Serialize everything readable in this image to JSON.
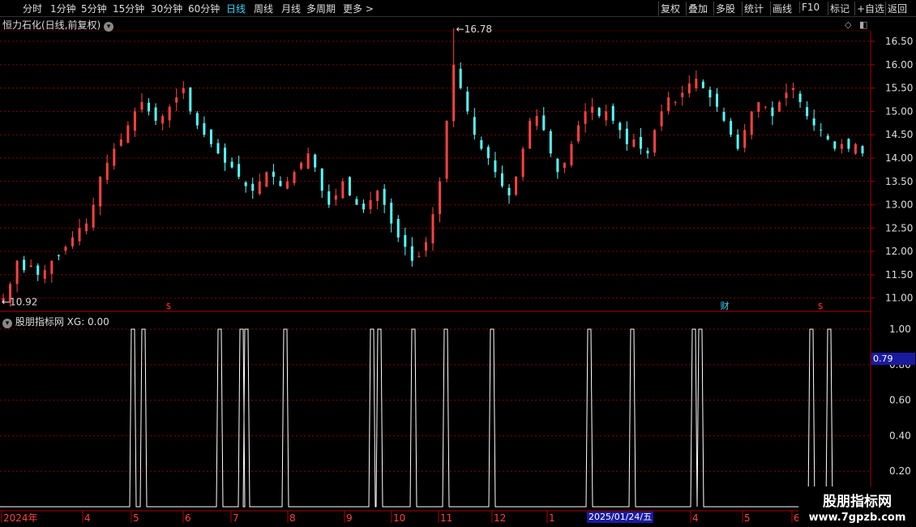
{
  "toolbar": {
    "periods": [
      "分时",
      "1分钟",
      "5分钟",
      "15分钟",
      "30分钟",
      "60分钟",
      "日线",
      "周线",
      "月线",
      "多周期",
      "更多 >"
    ],
    "active_period": "日线",
    "tools": [
      "复权",
      "叠加",
      "多股",
      "统计",
      "画线",
      "F10",
      "标记",
      "+自选",
      "返回"
    ]
  },
  "main_panel": {
    "title": "恒力石化(日线,前复权)",
    "high_label": "16.78",
    "low_label": "10.92",
    "price_axis": [
      "16.50",
      "16.00",
      "15.50",
      "15.00",
      "14.50",
      "14.00",
      "13.50",
      "13.00",
      "12.50",
      "12.00",
      "11.50",
      "11.00"
    ],
    "markers": [
      {
        "text": "$",
        "color": "#ff3030"
      },
      {
        "text": "财",
        "color": "#33d8ff"
      },
      {
        "text": "$",
        "color": "#ff3030"
      }
    ]
  },
  "indicator_panel": {
    "title": "股朋指标网",
    "value_label": "XG: 0.00",
    "axis": [
      "1.00",
      "0.80",
      "0.60",
      "0.40",
      "0.20"
    ],
    "cursor_value": "0.79"
  },
  "date_axis": {
    "labels": [
      "2024年",
      "4",
      "5",
      "6",
      "7",
      "8",
      "9",
      "10",
      "11",
      "12",
      "1",
      "4",
      "5",
      "6"
    ],
    "highlight_date": "2025/01/24/五"
  },
  "watermark": {
    "line1": "股朋指标网",
    "line2": "www.7gpzb.com"
  },
  "colors": {
    "up": "#ff4040",
    "down": "#54fcfc",
    "grid": "#8b0000",
    "signal": "#ffffff",
    "accent": "#33d8ff"
  },
  "chart_data": {
    "type": "candlestick",
    "price_range": [
      10.7,
      16.9
    ],
    "high": 16.78,
    "low": 10.92,
    "close_trajectory": [
      11.0,
      11.3,
      11.8,
      11.6,
      11.7,
      11.5,
      11.6,
      11.8,
      11.9,
      12.1,
      12.3,
      12.5,
      12.6,
      13.0,
      13.6,
      13.9,
      14.2,
      14.4,
      14.7,
      15.0,
      15.2,
      15.0,
      14.8,
      14.9,
      15.1,
      15.3,
      15.5,
      15.0,
      14.7,
      14.5,
      14.3,
      14.1,
      13.9,
      13.8,
      13.6,
      13.4,
      13.3,
      13.5,
      13.7,
      13.6,
      13.4,
      13.5,
      13.7,
      13.9,
      14.1,
      13.8,
      13.3,
      13.0,
      13.2,
      13.5,
      13.2,
      13.0,
      12.9,
      13.1,
      13.3,
      13.0,
      12.6,
      12.3,
      12.1,
      11.8,
      11.9,
      12.2,
      12.8,
      13.5,
      14.8,
      16.0,
      15.5,
      15.0,
      14.5,
      14.2,
      14.0,
      13.7,
      13.4,
      13.2,
      13.6,
      14.2,
      14.8,
      14.9,
      14.6,
      14.1,
      13.7,
      13.9,
      14.3,
      14.7,
      15.0,
      15.1,
      14.9,
      15.0,
      14.8,
      14.6,
      14.3,
      14.4,
      14.2,
      14.1,
      14.6,
      15.0,
      15.3,
      15.2,
      15.4,
      15.6,
      15.7,
      15.5,
      15.3,
      15.1,
      14.8,
      14.5,
      14.2,
      14.6,
      15.0,
      15.2,
      15.1,
      14.9,
      15.2,
      15.4,
      15.5,
      15.2,
      14.9,
      14.7,
      14.6,
      14.4,
      14.2,
      14.3,
      14.2,
      14.3,
      14.1
    ],
    "signal_count": 22
  }
}
